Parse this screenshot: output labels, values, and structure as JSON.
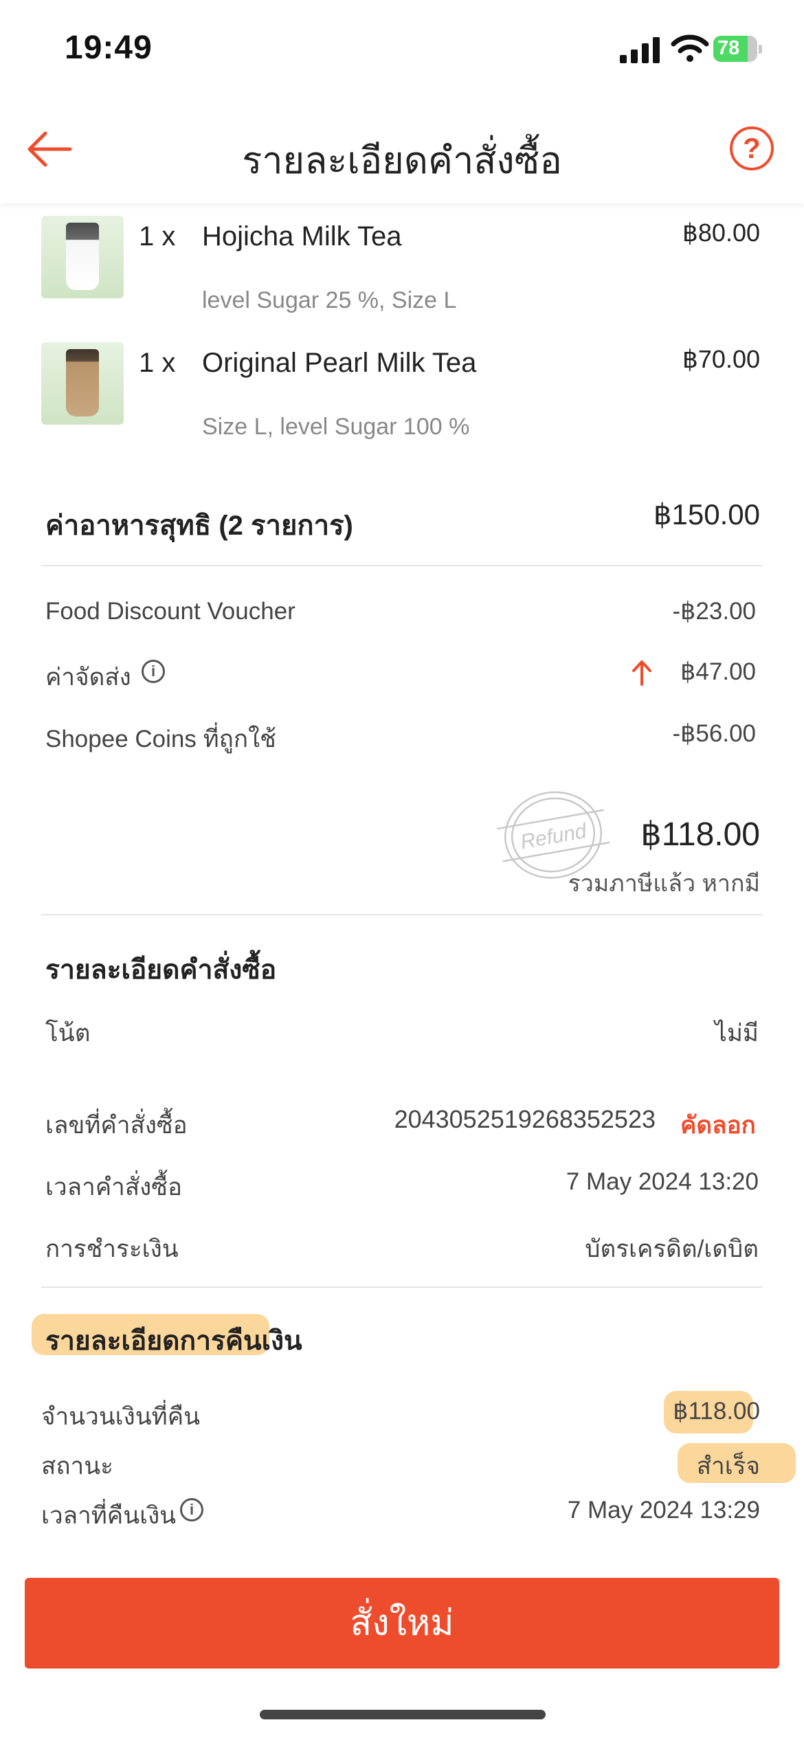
{
  "status_bar": {
    "time": "19:49",
    "battery": "78",
    "battery_fraction": 0.78
  },
  "header": {
    "title": "รายละเอียดคำสั่งซื้อ",
    "help": "?"
  },
  "items": [
    {
      "qty": "1 x",
      "name": "Hojicha Milk Tea",
      "options": "level Sugar 25 %, Size L",
      "price": "฿80.00",
      "image": "hojicha-milk-tea-image"
    },
    {
      "qty": "1 x",
      "name": "Original Pearl Milk Tea",
      "options": "Size L, level Sugar 100 %",
      "price": "฿70.00",
      "image": "pearl-milk-tea-image"
    }
  ],
  "subtotal": {
    "label": "ค่าอาหารสุทธิ (2 รายการ)",
    "value": "฿150.00"
  },
  "charges": [
    {
      "label": "Food Discount Voucher",
      "value": "-฿23.00"
    },
    {
      "label": "ค่าจัดส่ง",
      "value": "฿47.00"
    },
    {
      "label": "Shopee Coins ที่ถูกใช้",
      "value": "-฿56.00"
    }
  ],
  "total": {
    "value": "฿118.00",
    "note": "รวมภาษีแล้ว หากมี",
    "stamp": "Refund"
  },
  "order_details": {
    "heading": "รายละเอียดคำสั่งซื้อ",
    "note_label": "โน้ต",
    "note_value": "ไม่มี",
    "order_no_label": "เลขที่คำสั่งซื้อ",
    "order_no_value": "2043052519268352523",
    "copy_label": "คัดลอก",
    "time_label": "เวลาคำสั่งซื้อ",
    "time_value": "7 May 2024 13:20",
    "payment_label": "การชำระเงิน",
    "payment_value": "บัตรเครดิต/เดบิต"
  },
  "refund_details": {
    "heading": "รายละเอียดการคืนเงิน",
    "amount_label": "จำนวนเงินที่คืน",
    "amount_value": "฿118.00",
    "status_label": "สถานะ",
    "status_value": "สำเร็จ",
    "time_label": "เวลาที่คืนเงิน",
    "time_value": "7 May 2024 13:29"
  },
  "reorder_button": "สั่งใหม่",
  "colors": {
    "accent": "#ee4d2d",
    "highlight": "#fbc97a"
  }
}
